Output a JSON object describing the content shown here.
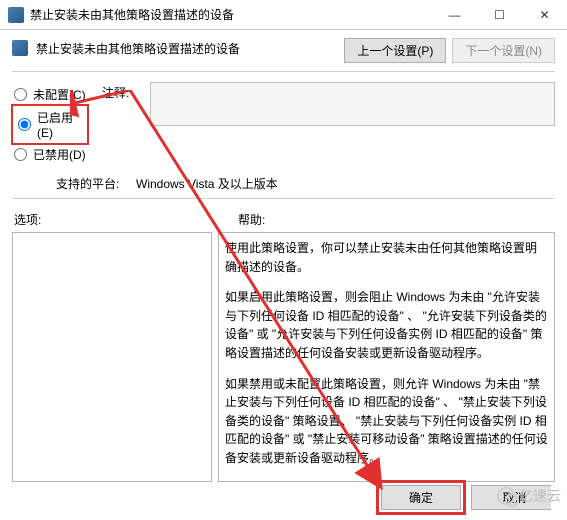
{
  "window": {
    "title": "禁止安装未由其他策略设置描述的设备",
    "min_icon": "—",
    "max_icon": "☐",
    "close_icon": "✕"
  },
  "header": {
    "title": "禁止安装未由其他策略设置描述的设备",
    "prev_btn": "上一个设置(P)",
    "next_btn": "下一个设置(N)"
  },
  "radios": {
    "not_configured": "未配置(C)",
    "enabled": "已启用(E)",
    "disabled": "已禁用(D)",
    "selected": "enabled"
  },
  "comment": {
    "label": "注释:",
    "value": ""
  },
  "platform": {
    "label": "支持的平台:",
    "value": "Windows Vista 及以上版本"
  },
  "columns": {
    "options_label": "选项:",
    "help_label": "帮助:"
  },
  "help_paragraphs": [
    "使用此策略设置，你可以禁止安装未由任何其他策略设置明确描述的设备。",
    "如果启用此策略设置，则会阻止 Windows 为未由 \"允许安装与下列任何设备 ID 相匹配的设备\" 、 \"允许安装下列设备类的设备\" 或 \"允许安装与下列任何设备实例 ID 相匹配的设备\" 策略设置描述的任何设备安装或更新设备驱动程序。",
    "如果禁用或未配置此策略设置，则允许 Windows 为未由 \"禁止安装与下列任何设备 ID 相匹配的设备\" 、 \"禁止安装下列设备类的设备\" 策略设置、 \"禁止安装与下列任何设备实例 ID 相匹配的设备\" 或 \"禁止安装可移动设备\" 策略设置描述的任何设备安装或更新设备驱动程序。"
  ],
  "footer": {
    "ok": "确定",
    "cancel": "取消"
  },
  "watermark": "亿速云",
  "annotation_colors": {
    "highlight": "#e03030"
  }
}
